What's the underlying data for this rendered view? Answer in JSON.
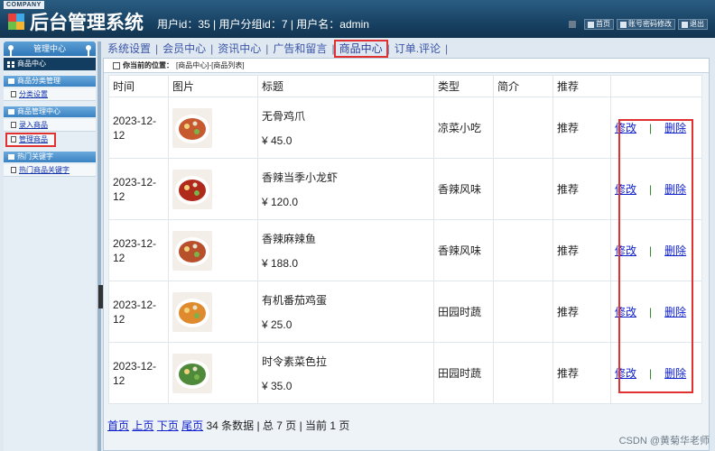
{
  "header": {
    "company_tag": "COMPANY",
    "title": "后台管理系统",
    "user_info": "用户id：35 | 用户分组id：7 | 用户名：admin",
    "links": [
      {
        "label": "首页",
        "icon": "home-icon"
      },
      {
        "label": "账号密码修改",
        "icon": "key-icon"
      },
      {
        "label": "退出",
        "icon": "power-icon"
      }
    ]
  },
  "sidebar": {
    "top_label": "管理中心",
    "active_label": "商品中心",
    "sections": [
      {
        "title": "商品分类管理",
        "items": [
          "分类设置"
        ]
      },
      {
        "title": "商品管理中心",
        "items": [
          "录入商品",
          "管理商品"
        ]
      },
      {
        "title": "热门关键字",
        "items": [
          "热门商品关键字"
        ]
      }
    ]
  },
  "tabs": [
    "系统设置",
    "会员中心",
    "资讯中心",
    "广告和留言",
    "商品中心",
    "订单.评论"
  ],
  "breadcrumb": {
    "prefix": "你当前的位置：",
    "path": "[商品中心]-[商品列表]"
  },
  "table": {
    "columns": [
      "时间",
      "图片",
      "标题",
      "类型",
      "简介",
      "推荐",
      ""
    ],
    "rows": [
      {
        "date": "2023-12-12",
        "name": "无骨鸡爪",
        "price": "¥ 45.0",
        "type": "凉菜小吃",
        "intro": "",
        "rec": "推荐",
        "img_color": "#c65a2e"
      },
      {
        "date": "2023-12-12",
        "name": "香辣当季小龙虾",
        "price": "¥ 120.0",
        "type": "香辣风味",
        "intro": "",
        "rec": "推荐",
        "img_color": "#b02a1c"
      },
      {
        "date": "2023-12-12",
        "name": "香辣麻辣鱼",
        "price": "¥ 188.0",
        "type": "香辣风味",
        "intro": "",
        "rec": "推荐",
        "img_color": "#b8502c"
      },
      {
        "date": "2023-12-12",
        "name": "有机番茄鸡蛋",
        "price": "¥ 25.0",
        "type": "田园时蔬",
        "intro": "",
        "rec": "推荐",
        "img_color": "#e08a2e"
      },
      {
        "date": "2023-12-12",
        "name": "时令素菜色拉",
        "price": "¥ 35.0",
        "type": "田园时蔬",
        "intro": "",
        "rec": "推荐",
        "img_color": "#4f8a3a"
      }
    ],
    "edit_label": "修改",
    "delete_label": "删除",
    "op_sep": "|"
  },
  "pager": {
    "first": "首页",
    "prev": "上页",
    "next": "下页",
    "last": "尾页",
    "summary": "34 条数据 | 总 7 页 | 当前 1 页"
  },
  "watermark": "CSDN @黄菊华老师"
}
